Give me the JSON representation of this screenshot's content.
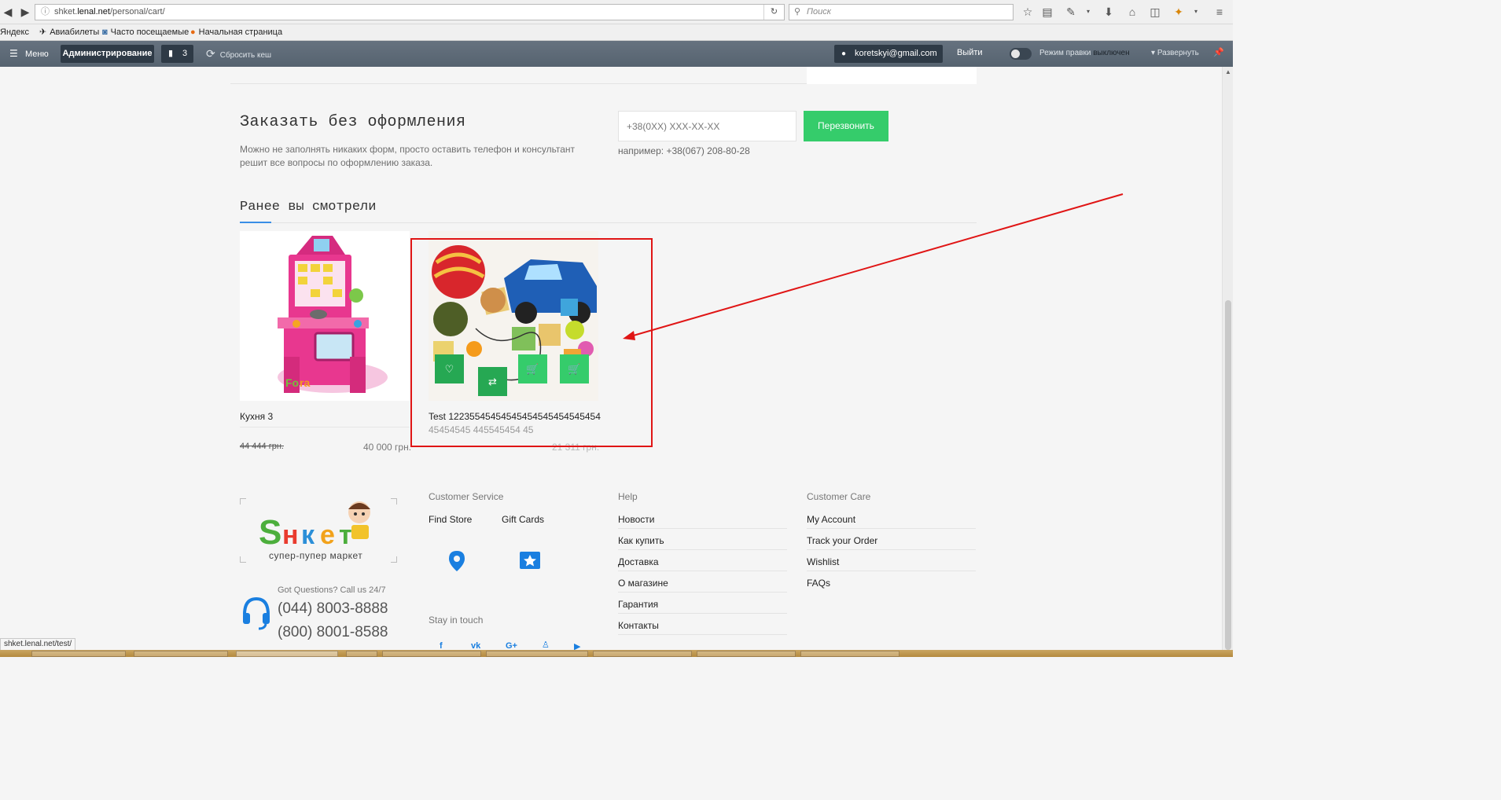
{
  "browser": {
    "url_prefix": "shket.",
    "url_host": "lenal.net",
    "url_path": "/personal/cart/",
    "search_placeholder": "Поиск"
  },
  "bookmarks": [
    {
      "label": "Яндекс",
      "icon": "yandex-icon"
    },
    {
      "label": "Авиабилеты",
      "icon": "plane-icon"
    },
    {
      "label": "Часто посещаемые",
      "icon": "history-icon"
    },
    {
      "label": "Начальная страница",
      "icon": "firefox-icon"
    }
  ],
  "admin_bar": {
    "menu_label": "Меню",
    "admin_label": "Администрирование",
    "notifications_count": "3",
    "reset_cache_label": "Сбросить кеш",
    "user_email": "koretskyi@gmail.com",
    "logout_label": "Выйти",
    "edit_mode_label": "Режим правки",
    "edit_mode_state": "выключен",
    "expand_label": "Развернуть"
  },
  "quick_order": {
    "title": "Заказать без оформления",
    "description": "Можно не заполнять никаких форм, просто оставить телефон и консультант решит все вопросы по оформлению заказа.",
    "phone_placeholder": "+38(0XX) XXX-XX-XX",
    "button_label": "Перезвонить",
    "hint": "например: +38(067) 208-80-28"
  },
  "recently_viewed": {
    "title": "Ранее вы смотрели",
    "products": [
      {
        "name": "Кухня 3",
        "old_price": "44 444 грн.",
        "price": "40 000 грн."
      },
      {
        "name": "Test 12235545454545454545454545454",
        "name_line2": "45454545 445545454 45",
        "price": "21 311 грн."
      }
    ]
  },
  "footer": {
    "tagline": "супер-пупер маркет",
    "got_questions": "Got Questions? Call us 24/7",
    "phones": [
      "(044) 8003-8888",
      "(800) 8001-8588"
    ],
    "customer_service": {
      "heading": "Customer Service",
      "links": [
        "Find Store",
        "Gift Cards"
      ],
      "stay_in_touch": "Stay in touch",
      "social": [
        "facebook-icon",
        "vk-icon",
        "google-plus-icon",
        "odnoklassniki-icon",
        "youtube-icon"
      ]
    },
    "help": {
      "heading": "Help",
      "links": [
        "Новости",
        "Как купить",
        "Доставка",
        "О магазине",
        "Гарантия",
        "Контакты"
      ]
    },
    "customer_care": {
      "heading": "Customer Care",
      "links": [
        "My Account",
        "Track your Order",
        "Wishlist",
        "FAQs"
      ]
    }
  },
  "status_bar": {
    "link_preview": "shket.lenal.net/test/"
  },
  "colors": {
    "accent_green": "#35cc6b",
    "dark_green": "#26a853",
    "link_blue": "#1a7fe0",
    "annotation_red": "#e01515"
  }
}
